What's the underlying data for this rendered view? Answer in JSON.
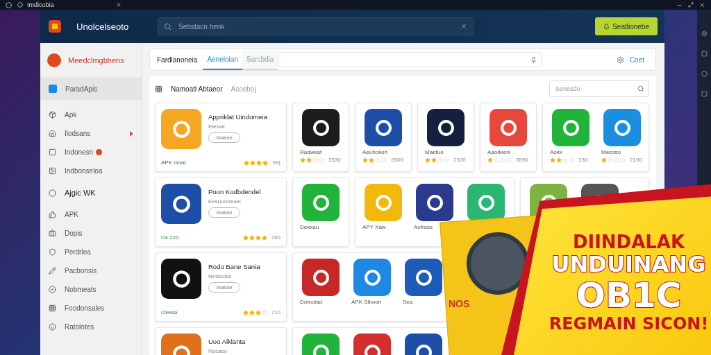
{
  "browser": {
    "tab_title": "Imdicobia"
  },
  "header": {
    "brand": "Unolcelseoto",
    "search": {
      "placeholder": "Sebstacn henk"
    },
    "action": "Seatlionebe"
  },
  "sidebar": {
    "title": "Meedclmgbhens",
    "items": [
      {
        "label": "ParadApis",
        "selected": true,
        "kind": "item"
      },
      {
        "label": "Apk",
        "selected": false,
        "kind": "item"
      },
      {
        "label": "Ilodsans",
        "selected": false,
        "kind": "arrow"
      },
      {
        "label": "Indonesn",
        "selected": false,
        "kind": "badge"
      },
      {
        "label": "Indbonseloa",
        "selected": false,
        "kind": "item"
      },
      {
        "label": "Ajgic WK",
        "selected": false,
        "kind": "heading"
      },
      {
        "label": "APK",
        "selected": false,
        "kind": "item"
      },
      {
        "label": "Dopis",
        "selected": false,
        "kind": "item"
      },
      {
        "label": "Perdrlea",
        "selected": false,
        "kind": "item"
      },
      {
        "label": "Pacbonsis",
        "selected": false,
        "kind": "item"
      },
      {
        "label": "Nobmeats",
        "selected": false,
        "kind": "item"
      },
      {
        "label": "Foodonsales",
        "selected": false,
        "kind": "item"
      },
      {
        "label": "Ratolotes",
        "selected": false,
        "kind": "item"
      }
    ]
  },
  "topbar": {
    "title": "Fardlanoneia",
    "tabs": [
      {
        "label": "Aeneloian",
        "selected": true
      },
      {
        "label": "Sarcbdia",
        "selected": false
      }
    ],
    "action": "Coet"
  },
  "section": {
    "title": "Namoatl Abtaeor",
    "subtitle": "Asoeboj",
    "search": {
      "placeholder": "Senesdo"
    }
  },
  "rows": [
    {
      "wide": {
        "title": "Appriklat Uindomeia",
        "subtitle": "Elesse",
        "button": "Inasse",
        "label": "APK Gdat",
        "stars": 4,
        "count": "99)",
        "color": "#f5a623"
      },
      "groups": [
        {
          "apps": [
            {
              "name": "Radwkat",
              "stars": 2,
              "count": "3530",
              "color": "#1c1c1c"
            }
          ]
        },
        {
          "apps": [
            {
              "name": "Aeuhokeh",
              "stars": 2,
              "count": "2500",
              "color": "#1e4fa8"
            }
          ]
        },
        {
          "apps": [
            {
              "name": "Maefuo",
              "stars": 2,
              "count": "2500",
              "color": "#14213d"
            }
          ]
        },
        {
          "apps": [
            {
              "name": "Aaodkeni",
              "stars": 1,
              "count": "3590",
              "color": "#e8483b"
            }
          ]
        },
        {
          "apps": [
            {
              "name": "Aokk",
              "stars": 2,
              "count": "330",
              "color": "#22b33a"
            },
            {
              "name": "Mecoso",
              "stars": 1,
              "count": "2190",
              "color": "#1a8fe0"
            }
          ]
        }
      ]
    },
    {
      "wide": {
        "title": "Poon Kodbdendel",
        "subtitle": "Eesuuoneael",
        "button": "Inasse",
        "label": "Ок 2z0",
        "stars": 4,
        "count": "190",
        "color": "#1e4fa8"
      },
      "groups": [
        {
          "apps": [
            {
              "name": "Dekkau",
              "color": "#22b33a"
            }
          ]
        },
        {
          "apps": [
            {
              "name": "APY Xaw",
              "color": "#f0b90b"
            },
            {
              "name": "Aofress",
              "color": "#2a3a8c"
            },
            {
              "color": "#2bb673"
            }
          ]
        },
        {
          "apps": [
            {
              "color": "#7cb342"
            },
            {
              "color": "#555555"
            }
          ]
        }
      ]
    },
    {
      "wide": {
        "title": "Rodo Bane Sania",
        "subtitle": "Netacoks",
        "button": "Inasse",
        "label": "Ovesa",
        "stars": 3,
        "count": "710",
        "color": "#111111"
      },
      "groups": [
        {
          "apps": [
            {
              "name": "Dotnolad",
              "color": "#c62828"
            },
            {
              "name": "APK Siboon",
              "color": "#1e88e5"
            },
            {
              "name": "Sea",
              "color": "#1e5bb8"
            }
          ]
        }
      ]
    },
    {
      "wide": {
        "title": "Uoo Alklanta",
        "subtitle": "Racaso",
        "color": "#e0701a"
      },
      "groups": [
        {
          "apps": [
            {
              "color": "#22b33a"
            },
            {
              "color": "#d32f2f"
            },
            {
              "color": "#1e4fa8"
            }
          ]
        }
      ]
    }
  ],
  "banner": {
    "card_label": "NOS",
    "lines": [
      "DIINDALAK",
      "UNDUINANG",
      "OB1C",
      "REGMAIN SICON!"
    ]
  }
}
